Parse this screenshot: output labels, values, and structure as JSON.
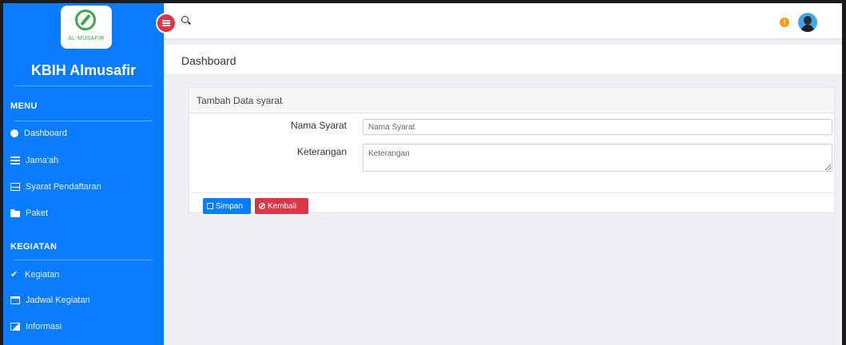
{
  "sidebar": {
    "logo_text": "AL-MUSAFIR",
    "brand": "KBIH Almusafir",
    "sections": [
      {
        "title": "MENU",
        "items": [
          {
            "label": "Dashboard",
            "icon": "dashboard-icon"
          },
          {
            "label": "Jama'ah",
            "icon": "list-icon"
          },
          {
            "label": "Syarat Pendaftaran",
            "icon": "table-icon"
          },
          {
            "label": "Paket",
            "icon": "folder-icon"
          }
        ]
      },
      {
        "title": "KEGIATAN",
        "items": [
          {
            "label": "Kegiatan",
            "icon": "check-icon"
          },
          {
            "label": "Jadwal Kegiatan",
            "icon": "calendar-icon"
          },
          {
            "label": "Informasi",
            "icon": "image-icon"
          }
        ]
      }
    ]
  },
  "page": {
    "title": "Dashboard"
  },
  "form": {
    "title": "Tambah Data syarat",
    "fields": [
      {
        "label": "Nama Syarat",
        "placeholder": "Nama Syarat",
        "value": ""
      },
      {
        "label": "Keterangan",
        "placeholder": "Keterangan",
        "value": ""
      }
    ],
    "buttons": {
      "save": "Simpan",
      "back": "Kembali"
    }
  },
  "colors": {
    "sidebar": "#0a7cff",
    "danger": "#dc3545",
    "warning": "#f39c12",
    "background": "#eef0f4"
  }
}
